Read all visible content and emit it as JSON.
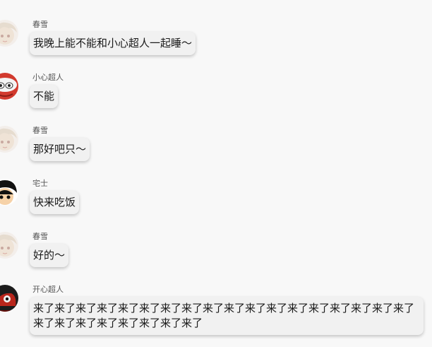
{
  "messages": [
    {
      "sender": "春雪",
      "text": "我晚上能不能和小心超人一起睡～",
      "avatar": "chunxue-avatar"
    },
    {
      "sender": "小心超人",
      "text": "不能",
      "avatar": "xiaoxin-avatar"
    },
    {
      "sender": "春雪",
      "text": "那好吧只～",
      "avatar": "chunxue-avatar"
    },
    {
      "sender": "宅士",
      "text": "快来吃饭",
      "avatar": "zhaishi-avatar"
    },
    {
      "sender": "春雪",
      "text": "好的～",
      "avatar": "chunxue-avatar"
    },
    {
      "sender": "开心超人",
      "text": "来了来了来了来了来了来了来了来了来了来了来了来了来了来了来了来了来了来了来了来了来了来了来了来了来了来了",
      "avatar": "kaixin-avatar"
    }
  ],
  "colors": {
    "background": "#f8f8f8",
    "bubble": "#f1f1f1"
  }
}
